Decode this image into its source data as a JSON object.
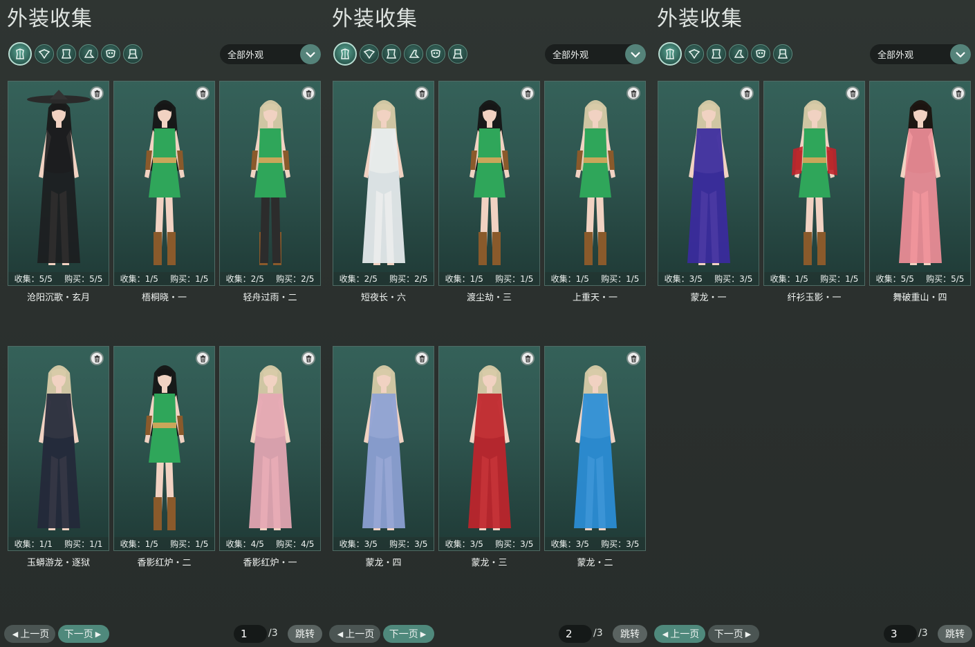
{
  "panels": [
    {
      "title": "外装收集",
      "filter_label": "全部外观",
      "pager": {
        "prev": "上一页",
        "next": "下一页",
        "page": "1",
        "total": "/3",
        "jump": "跳转",
        "highlight": "next"
      },
      "cards": [
        {
          "stats_collect": "收集：5/5",
          "stats_buy": "购买：5/5",
          "name": "沧阳沉歌・玄月",
          "outfit": "black",
          "hair": "#1a1a1a",
          "hat": true
        },
        {
          "stats_collect": "收集：1/5",
          "stats_buy": "购买：1/5",
          "name": "梧桐晓・一",
          "outfit": "green",
          "hair": "#161616"
        },
        {
          "stats_collect": "收集：2/5",
          "stats_buy": "购买：2/5",
          "name": "轻舟过雨・二",
          "outfit": "green-dark",
          "hair": "#d8cba8"
        },
        {
          "stats_collect": "收集：1/1",
          "stats_buy": "购买：1/1",
          "name": "玉蟒游龙・逐狱",
          "outfit": "black-blue",
          "hair": "#d8cba8"
        },
        {
          "stats_collect": "收集：1/5",
          "stats_buy": "购买：1/5",
          "name": "香影红炉・二",
          "outfit": "green",
          "hair": "#161616"
        },
        {
          "stats_collect": "收集：4/5",
          "stats_buy": "购买：4/5",
          "name": "香影红炉・一",
          "outfit": "pink",
          "hair": "#d8cba8"
        }
      ]
    },
    {
      "title": "外装收集",
      "filter_label": "全部外观",
      "pager": {
        "prev": "上一页",
        "next": "下一页",
        "page": "2",
        "total": "/3",
        "jump": "跳转",
        "highlight": "next"
      },
      "cards": [
        {
          "stats_collect": "收集：2/5",
          "stats_buy": "购买：2/5",
          "name": "短夜长・六",
          "outfit": "white",
          "hair": "#d8cba8"
        },
        {
          "stats_collect": "收集：1/5",
          "stats_buy": "购买：1/5",
          "name": "渡尘劫・三",
          "outfit": "green",
          "hair": "#161616"
        },
        {
          "stats_collect": "收集：1/5",
          "stats_buy": "购买：1/5",
          "name": "上重天・一",
          "outfit": "green",
          "hair": "#d8cba8"
        },
        {
          "stats_collect": "收集：3/5",
          "stats_buy": "购买：3/5",
          "name": "蒙龙・四",
          "outfit": "lavender",
          "hair": "#d8cba8"
        },
        {
          "stats_collect": "收集：3/5",
          "stats_buy": "购买：3/5",
          "name": "蒙龙・三",
          "outfit": "red",
          "hair": "#d8cba8"
        },
        {
          "stats_collect": "收集：3/5",
          "stats_buy": "购买：3/5",
          "name": "蒙龙・二",
          "outfit": "blue",
          "hair": "#d8cba8"
        }
      ]
    },
    {
      "title": "外装收集",
      "filter_label": "全部外观",
      "pager": {
        "prev": "上一页",
        "next": "下一页",
        "page": "3",
        "total": "/3",
        "jump": "跳转",
        "highlight": "prev"
      },
      "cards": [
        {
          "stats_collect": "收集：3/5",
          "stats_buy": "购买：3/5",
          "name": "蒙龙・一",
          "outfit": "purple",
          "hair": "#d8cba8"
        },
        {
          "stats_collect": "收集：1/5",
          "stats_buy": "购买：1/5",
          "name": "纤衫玉影・一",
          "outfit": "green-red",
          "hair": "#d8cba8"
        },
        {
          "stats_collect": "收集：5/5",
          "stats_buy": "购买：5/5",
          "name": "舞破重山・四",
          "outfit": "pink-full",
          "hair": "#1c1410"
        }
      ]
    }
  ],
  "palette": {
    "black": "#1c1d1f",
    "green": "#2fa65a",
    "green-dark": "#2fa65a",
    "black-blue": "#24283a",
    "pink": "#e6a7b4",
    "white": "#e9eef0",
    "lavender": "#8ea2d6",
    "red": "#c0242b",
    "blue": "#2b8ed8",
    "purple": "#3b2aa0",
    "green-red": "#2fa65a",
    "pink-full": "#ef8e98"
  },
  "icons": [
    "upper-body-icon",
    "outfit-icon",
    "top-icon",
    "shoes-icon",
    "mask-icon",
    "pants-icon"
  ]
}
